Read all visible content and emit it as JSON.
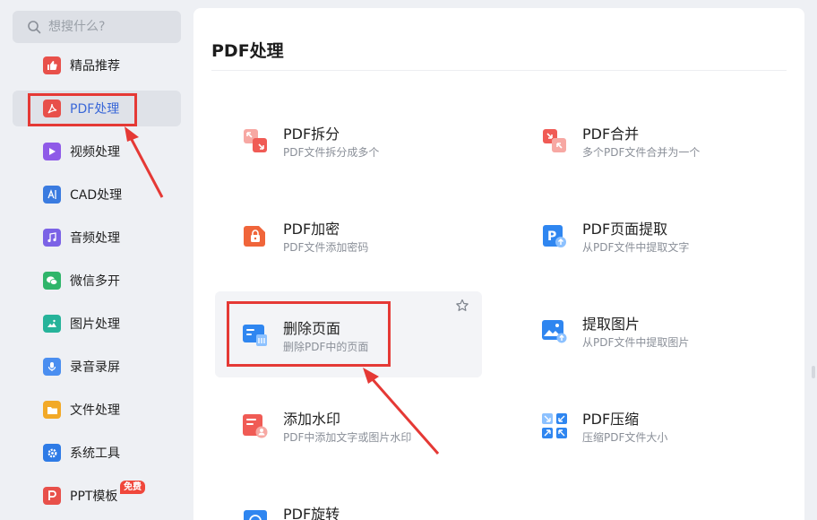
{
  "search": {
    "placeholder": "想搜什么?"
  },
  "sidebar": {
    "items": [
      {
        "label": "精品推荐",
        "icon": "thumbs-up-icon",
        "color": "#e8504a"
      },
      {
        "label": "PDF处理",
        "icon": "pdf-icon",
        "color": "#e8504a",
        "active": true
      },
      {
        "label": "视频处理",
        "icon": "play-icon",
        "color": "#8f5ae8"
      },
      {
        "label": "CAD处理",
        "icon": "cad-icon",
        "color": "#3a7be0"
      },
      {
        "label": "音频处理",
        "icon": "music-icon",
        "color": "#7b62e6"
      },
      {
        "label": "微信多开",
        "icon": "wechat-icon",
        "color": "#2fb56a"
      },
      {
        "label": "图片处理",
        "icon": "image-icon",
        "color": "#26b39a"
      },
      {
        "label": "录音录屏",
        "icon": "microphone-icon",
        "color": "#4a8ef0"
      },
      {
        "label": "文件处理",
        "icon": "folder-icon",
        "color": "#f2a927"
      },
      {
        "label": "系统工具",
        "icon": "gear-icon",
        "color": "#2e7be6"
      },
      {
        "label": "PPT模板",
        "icon": "ppt-icon",
        "color": "#e8504a",
        "badge": "免费"
      }
    ]
  },
  "main": {
    "title": "PDF处理",
    "tools": [
      {
        "name": "PDF拆分",
        "desc": "PDF文件拆分成多个",
        "icon": "split-icon"
      },
      {
        "name": "PDF合并",
        "desc": "多个PDF文件合并为一个",
        "icon": "merge-icon"
      },
      {
        "name": "PDF加密",
        "desc": "PDF文件添加密码",
        "icon": "lock-icon"
      },
      {
        "name": "PDF页面提取",
        "desc": "从PDF文件中提取文字",
        "icon": "page-extract-icon"
      },
      {
        "name": "删除页面",
        "desc": "删除PDF中的页面",
        "icon": "delete-page-icon"
      },
      {
        "name": "提取图片",
        "desc": "从PDF文件中提取图片",
        "icon": "extract-image-icon"
      },
      {
        "name": "添加水印",
        "desc": "PDF中添加文字或图片水印",
        "icon": "watermark-icon"
      },
      {
        "name": "PDF压缩",
        "desc": "压缩PDF文件大小",
        "icon": "compress-icon"
      },
      {
        "name": "PDF旋转",
        "desc": "",
        "icon": "rotate-icon"
      }
    ]
  },
  "colors": {
    "accent": "#3a68d8",
    "annotation": "#e53935"
  }
}
